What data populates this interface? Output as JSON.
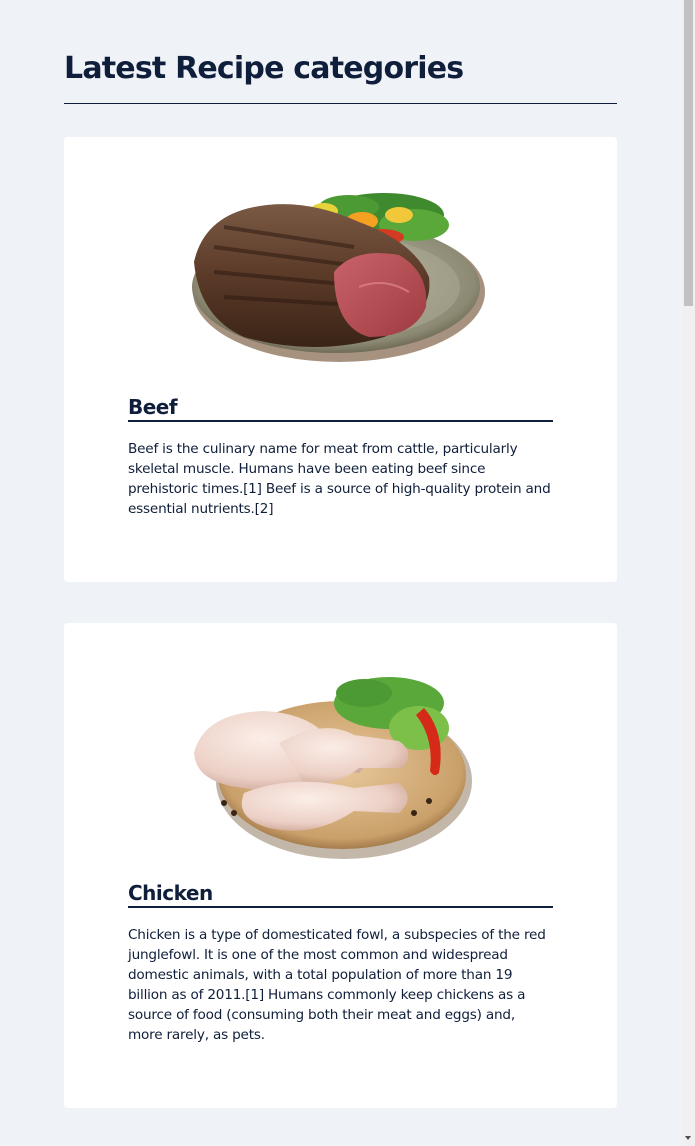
{
  "header": {
    "title": "Latest Recipe categories"
  },
  "categories": [
    {
      "name": "Beef",
      "image_icon": "beef-steak-plate-image",
      "description": "Beef is the culinary name for meat from cattle, particularly skeletal muscle. Humans have been eating beef since prehistoric times.[1] Beef is a source of high-quality protein and essential nutrients.[2]"
    },
    {
      "name": "Chicken",
      "image_icon": "raw-chicken-board-image",
      "description": "Chicken is a type of domesticated fowl, a subspecies of the red junglefowl. It is one of the most common and widespread domestic animals, with a total population of more than 19 billion as of 2011.[1] Humans commonly keep chickens as a source of food (consuming both their meat and eggs) and, more rarely, as pets."
    }
  ],
  "colors": {
    "page_background": "#eff3f8",
    "card_background": "#ffffff",
    "text_primary": "#0f1e3a"
  }
}
